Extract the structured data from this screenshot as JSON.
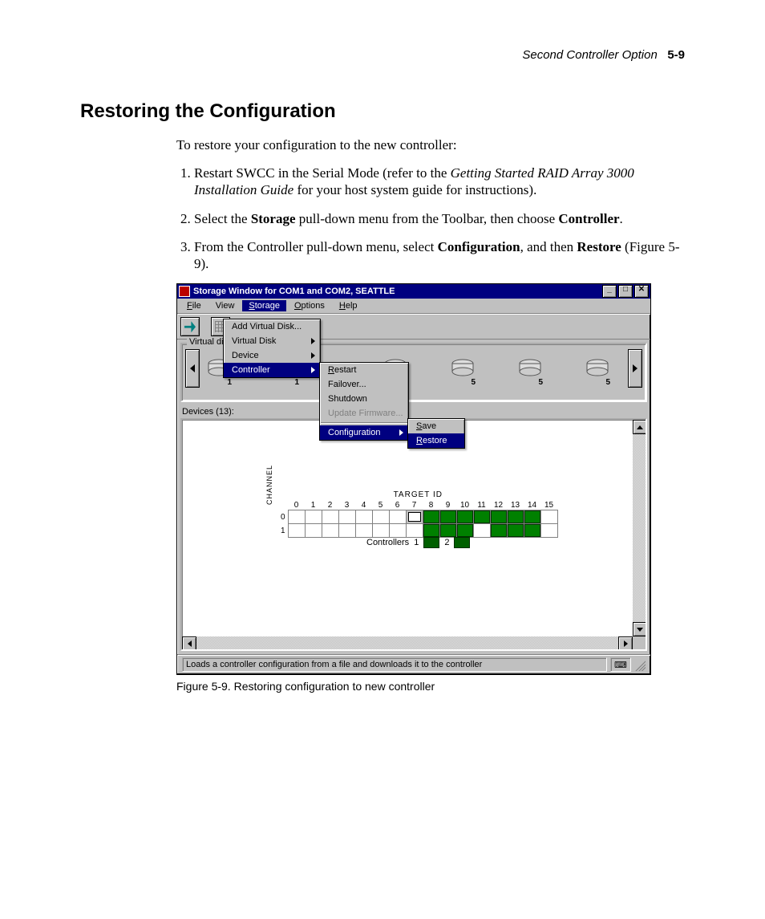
{
  "header": {
    "running": "Second Controller Option",
    "page": "5-9"
  },
  "section_title": "Restoring the Configuration",
  "lead": "To restore your configuration to the new controller:",
  "steps": [
    {
      "pre": "Restart SWCC in the Serial Mode (refer to the ",
      "ital": "Getting Started RAID Array 3000 Installation Guide",
      "post": " for your host system guide for instructions)."
    },
    {
      "pre": "Select the ",
      "b1": "Storage",
      "mid": " pull-down menu from the Toolbar, then choose ",
      "b2": "Controller",
      "post": "."
    },
    {
      "pre": "From the Controller pull-down menu, select ",
      "b1": "Configuration",
      "mid": ", and then ",
      "b2": "Restore",
      "post": " (Figure 5-9)."
    }
  ],
  "figcaption": "Figure 5-9.  Restoring configuration to new controller",
  "window": {
    "title": "Storage Window for COM1 and COM2, SEATTLE",
    "menus": {
      "file": "File",
      "view": "View",
      "storage": "Storage",
      "options": "Options",
      "help": "Help"
    },
    "storage_menu": {
      "add_vdisk": "Add Virtual Disk...",
      "vdisk": "Virtual Disk",
      "device": "Device",
      "controller": "Controller"
    },
    "controller_menu": {
      "restart": "Restart",
      "failover": "Failover...",
      "shutdown": "Shutdown",
      "update_fw": "Update Firmware...",
      "configuration": "Configuration"
    },
    "config_menu": {
      "save": "Save",
      "restore": "Restore"
    },
    "panels": {
      "vdisks_legend": "Virtual disks",
      "devices_legend": "Devices (13):"
    },
    "vdisk_labels": {
      "d1": "1",
      "d5": "5"
    },
    "target": {
      "title": "TARGET ID",
      "channel_label": "CHANNEL",
      "cols": [
        "0",
        "1",
        "2",
        "3",
        "4",
        "5",
        "6",
        "7",
        "8",
        "9",
        "10",
        "11",
        "12",
        "13",
        "14",
        "15"
      ],
      "rows": [
        "0",
        "1"
      ],
      "controllers_label": "Controllers",
      "ctl1": "1",
      "ctl2": "2"
    },
    "statusbar": "Loads a controller configuration from a file and downloads it to the controller"
  }
}
